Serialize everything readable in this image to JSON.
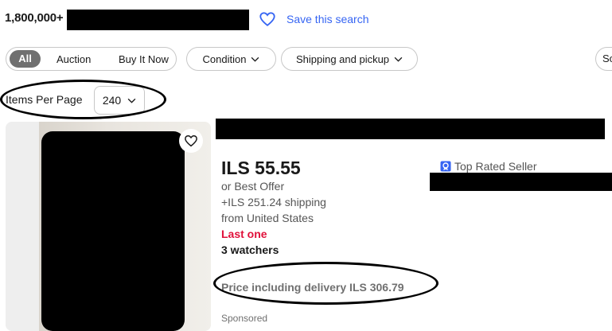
{
  "header": {
    "result_count": "1,800,000+",
    "save_search_label": "Save this search"
  },
  "filters": {
    "segmented": [
      "All",
      "Auction",
      "Buy It Now"
    ],
    "condition_label": "Condition",
    "shipping_label": "Shipping and pickup",
    "truncated_label": "Sort"
  },
  "items_per_page": {
    "label": "Items Per Page",
    "value": "240"
  },
  "listing": {
    "price": "ILS 55.55",
    "best_offer": "or Best Offer",
    "shipping": "+ILS 251.24 shipping",
    "origin": "from United States",
    "stock_status": "Last one",
    "watchers": "3 watchers",
    "price_including_delivery": "Price including delivery ILS 306.79",
    "sponsored": "Sponsored",
    "seller_badge": "Top Rated Seller"
  },
  "colors": {
    "link_blue": "#3665f3",
    "alert_red": "#e0103a",
    "chip_active": "#707070",
    "badge_blue": "#3665f3"
  }
}
